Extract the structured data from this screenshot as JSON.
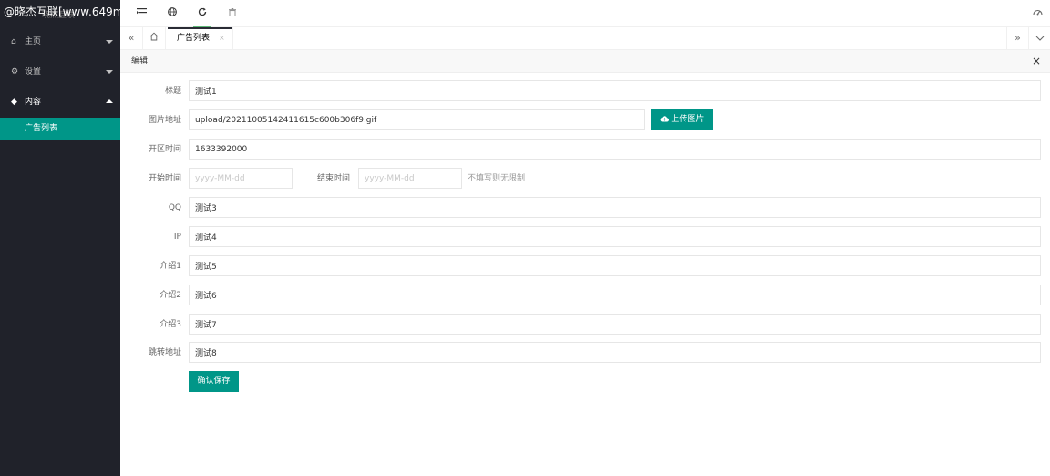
{
  "watermark": "@晓杰互联[www.649m",
  "logo_under": "晓杰互联",
  "sidebar": {
    "items": [
      {
        "label": "主页",
        "icon": "⌂"
      },
      {
        "label": "设置",
        "icon": "⚙"
      },
      {
        "label": "内容",
        "icon": "◆"
      }
    ],
    "sub_items": [
      {
        "label": "广告列表"
      }
    ]
  },
  "header": {
    "icons": [
      "menu-fold-icon",
      "globe-icon",
      "refresh-icon",
      "trash-icon"
    ],
    "right_icon": "theme-icon"
  },
  "tabs": [
    {
      "label": "广告列表",
      "close": "×"
    }
  ],
  "panel": {
    "title": "编辑",
    "close": "×"
  },
  "form": {
    "title_label": "标题",
    "title_value": "测试1",
    "image_label": "图片地址",
    "image_value": "upload/20211005142411615c600b306f9.gif",
    "upload_label": "上传图片",
    "open_time_label": "开区时间",
    "open_time_value": "1633392000",
    "start_label": "开始时间",
    "start_placeholder": "yyyy-MM-dd",
    "end_label": "结束时间",
    "end_placeholder": "yyyy-MM-dd",
    "time_hint": "不填写则无限制",
    "qq_label": "QQ",
    "qq_value": "测试3",
    "ip_label": "IP",
    "ip_value": "测试4",
    "intro1_label": "介绍1",
    "intro1_value": "测试5",
    "intro2_label": "介绍2",
    "intro2_value": "测试6",
    "intro3_label": "介绍3",
    "intro3_value": "测试7",
    "jump_label": "跳转地址",
    "jump_value": "测试8",
    "submit_label": "确认保存"
  },
  "colors": {
    "accent": "#009688",
    "sidebar_bg": "#20222a"
  }
}
